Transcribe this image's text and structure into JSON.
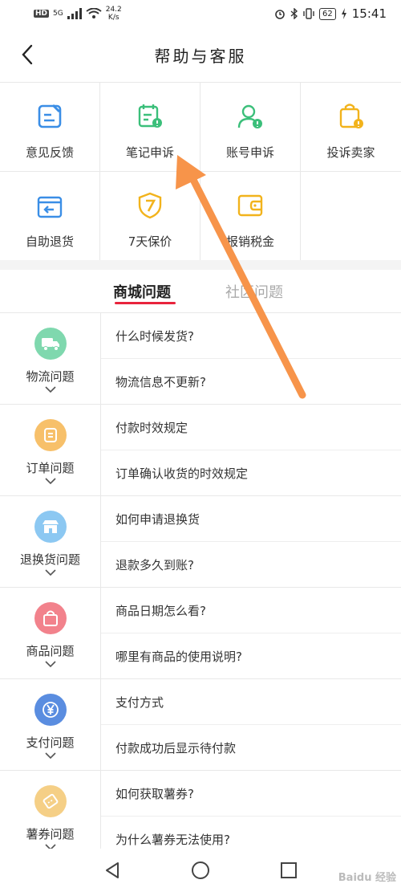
{
  "status_bar": {
    "network": "HD",
    "signal": "5G",
    "speed_value": "24.2",
    "speed_unit": "K/s",
    "battery": "62",
    "time": "15:41"
  },
  "header": {
    "title": "帮助与客服",
    "back_icon": "chevron-left-icon"
  },
  "services": [
    {
      "label": "意见反馈",
      "icon": "feedback-icon",
      "color": "#3a8ee6"
    },
    {
      "label": "笔记申诉",
      "icon": "note-appeal-icon",
      "color": "#3bbf7a"
    },
    {
      "label": "账号申诉",
      "icon": "account-appeal-icon",
      "color": "#3bbf7a"
    },
    {
      "label": "投诉卖家",
      "icon": "complain-seller-icon",
      "color": "#f2b31c"
    },
    {
      "label": "自助退货",
      "icon": "return-box-icon",
      "color": "#3a8ee6"
    },
    {
      "label": "7天保价",
      "icon": "price-protect-icon",
      "color": "#f2b31c"
    },
    {
      "label": "报销税金",
      "icon": "wallet-icon",
      "color": "#f2b31c"
    }
  ],
  "tabs": [
    {
      "label": "商城问题",
      "active": true
    },
    {
      "label": "社区问题",
      "active": false
    }
  ],
  "sections": [
    {
      "category": "物流问题",
      "icon": "truck-icon",
      "color": "#7fd8ae",
      "questions": [
        "什么时候发货?",
        "物流信息不更新?"
      ]
    },
    {
      "category": "订单问题",
      "icon": "order-icon",
      "color": "#f7c06a",
      "questions": [
        "付款时效规定",
        "订单确认收货的时效规定"
      ]
    },
    {
      "category": "退换货问题",
      "icon": "store-icon",
      "color": "#8cc8f2",
      "questions": [
        "如何申请退换货",
        "退款多久到账?"
      ]
    },
    {
      "category": "商品问题",
      "icon": "bag-icon",
      "color": "#f2828c",
      "questions": [
        "商品日期怎么看?",
        "哪里有商品的使用说明?"
      ]
    },
    {
      "category": "支付问题",
      "icon": "yen-icon",
      "color": "#5a8de0",
      "questions": [
        "支付方式",
        "付款成功后显示待付款"
      ]
    },
    {
      "category": "薯券问题",
      "icon": "coupon-icon",
      "color": "#f5cf86",
      "questions": [
        "如何获取薯券?",
        "为什么薯券无法使用?"
      ]
    }
  ],
  "nav": {
    "back": "nav-back-icon",
    "home": "nav-home-icon",
    "recent": "nav-recent-icon"
  },
  "annotation_color": "#f7944a",
  "watermark": "Baidu 经验"
}
